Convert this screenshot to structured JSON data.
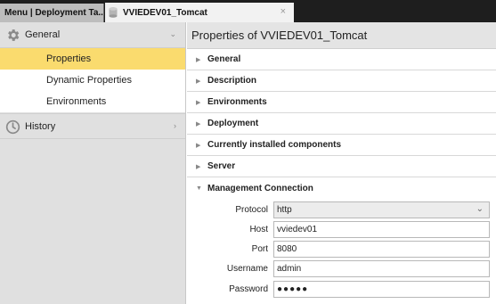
{
  "tabs": [
    {
      "label": "Menu | Deployment Ta..."
    },
    {
      "label": "VVIEDEV01_Tomcat",
      "close": "×"
    }
  ],
  "sidebar": {
    "groups": [
      {
        "label": "General",
        "icon": "gear-icon",
        "chevron": "⌄",
        "expanded": true,
        "items": [
          {
            "label": "Properties",
            "selected": true
          },
          {
            "label": "Dynamic Properties"
          },
          {
            "label": "Environments"
          }
        ]
      },
      {
        "label": "History",
        "icon": "clock-icon",
        "chevron": "›",
        "expanded": false
      }
    ]
  },
  "main": {
    "title": "Properties of VVIEDEV01_Tomcat",
    "sections": [
      {
        "label": "General",
        "expanded": false
      },
      {
        "label": "Description",
        "expanded": false
      },
      {
        "label": "Environments",
        "expanded": false
      },
      {
        "label": "Deployment",
        "expanded": false
      },
      {
        "label": "Currently installed components",
        "expanded": false
      },
      {
        "label": "Server",
        "expanded": false
      },
      {
        "label": "Management Connection",
        "expanded": true
      }
    ],
    "form": {
      "protocol": {
        "label": "Protocol",
        "value": "http"
      },
      "host": {
        "label": "Host",
        "value": "vviedev01"
      },
      "port": {
        "label": "Port",
        "value": "8080"
      },
      "username": {
        "label": "Username",
        "value": "admin"
      },
      "password": {
        "label": "Password",
        "value": "●●●●●"
      }
    }
  },
  "colors": {
    "tabbar": "#1e1e1e",
    "selected": "#fadb6e",
    "sidebar_bg": "#e0e0e0"
  }
}
